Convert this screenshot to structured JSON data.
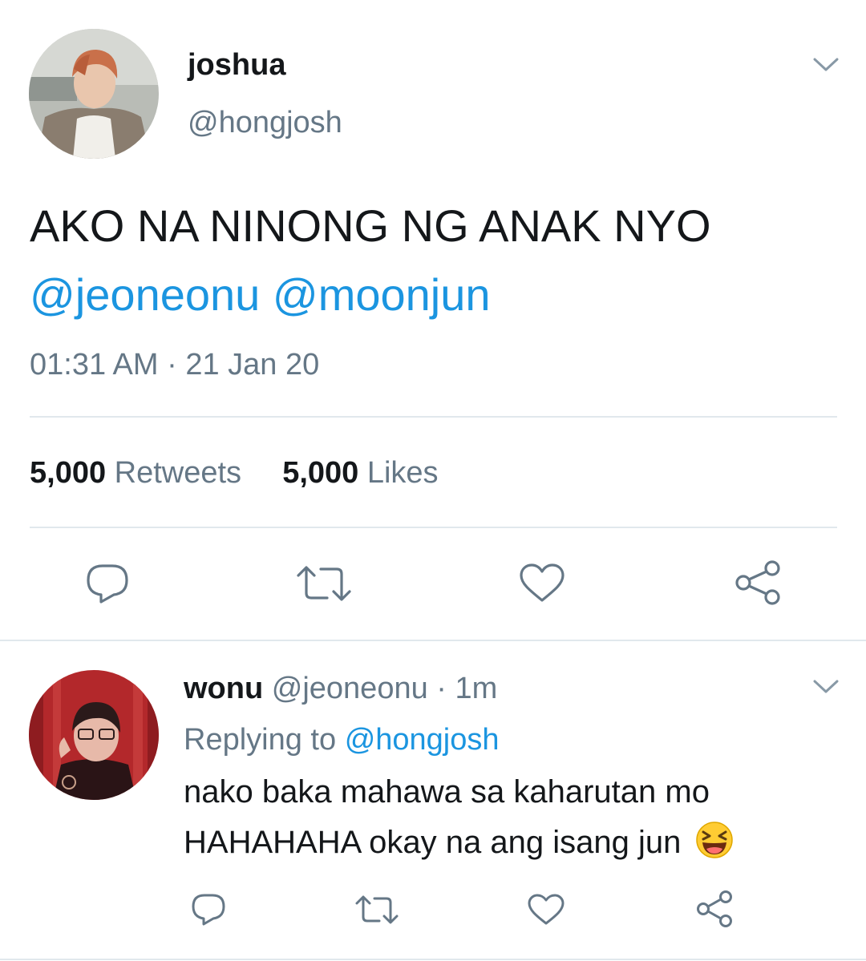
{
  "main_tweet": {
    "author_name": "joshua",
    "author_handle": "@hongjosh",
    "text": "AKO NA NINONG NG ANAK NYO",
    "mentions": [
      "@jeoneonu",
      "@moonjun"
    ],
    "timestamp": "01:31 AM · 21 Jan 20",
    "stats": {
      "retweets_count": "5,000",
      "retweets_label": "Retweets",
      "likes_count": "5,000",
      "likes_label": "Likes"
    },
    "actions": [
      "reply-icon",
      "retweet-icon",
      "like-icon",
      "share-icon"
    ]
  },
  "reply_tweet": {
    "author_name": "wonu",
    "author_handle": "@jeoneonu",
    "time_separator": "·",
    "time_ago": "1m",
    "replying_prefix": "Replying to",
    "replying_to": "@hongjosh",
    "text_line1": "nako baka mahawa sa kaharutan mo",
    "text_line2": "HAHAHAHA okay na ang isang jun",
    "emoji": "😆",
    "actions": [
      "reply-icon",
      "retweet-icon",
      "like-icon",
      "share-icon"
    ]
  },
  "colors": {
    "link": "#1b95e0",
    "muted": "#657786",
    "text": "#14171a",
    "divider": "#e1e8ed"
  }
}
